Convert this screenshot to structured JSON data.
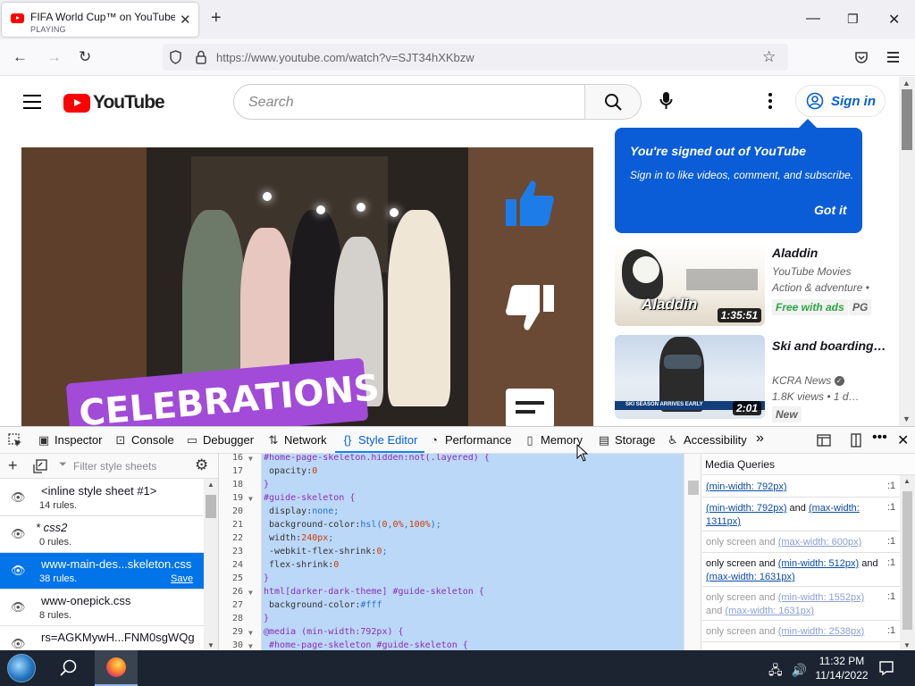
{
  "browser": {
    "tab_title": "FIFA World Cup™ on YouTube",
    "tab_status": "PLAYING",
    "url": "https://www.youtube.com/watch?v=SJT34hXKbzw"
  },
  "youtube": {
    "logo_text": "YouTube",
    "search_placeholder": "Search",
    "sign_in": "Sign in",
    "tooltip": {
      "heading": "You're signed out of YouTube",
      "subtext": "Sign in to like videos, comment, and subscribe.",
      "button": "Got it"
    },
    "video_overlay_text": "CELEBRATIONS",
    "recommendations": [
      {
        "title": "Aladdin",
        "channel": "YouTube Movies",
        "meta": "Action & adventure •",
        "duration": "1:35:51",
        "badge1": "Free with ads",
        "badge2": "PG",
        "thumb_caption": "Aladdin"
      },
      {
        "title": "Ski and boarding…",
        "channel": "KCRA News",
        "meta": "1.8K views  • 1 d…",
        "duration": "2:01",
        "badge1": "New",
        "thumb_caption": "SKI SEASON ARRIVES EARLY"
      }
    ]
  },
  "devtools": {
    "tabs": [
      {
        "label": "Inspector",
        "icon": "inspector-icon"
      },
      {
        "label": "Console",
        "icon": "console-icon"
      },
      {
        "label": "Debugger",
        "icon": "debugger-icon"
      },
      {
        "label": "Network",
        "icon": "network-icon"
      },
      {
        "label": "Style Editor",
        "icon": "style-editor-icon"
      },
      {
        "label": "Performance",
        "icon": "performance-icon"
      },
      {
        "label": "Memory",
        "icon": "memory-icon"
      },
      {
        "label": "Storage",
        "icon": "storage-icon"
      },
      {
        "label": "Accessibility",
        "icon": "accessibility-icon"
      }
    ],
    "selected_tab": "Style Editor",
    "filter_placeholder": "Filter style sheets",
    "stylesheets": [
      {
        "name": "<inline style sheet #1>",
        "rules": "14 rules."
      },
      {
        "name": "* css2",
        "rules": "0 rules."
      },
      {
        "name": "www-main-des...skeleton.css",
        "rules": "38 rules.",
        "save": "Save",
        "selected": true
      },
      {
        "name": "www-onepick.css",
        "rules": "8 rules."
      },
      {
        "name": "rs=AGKMywH...FNM0sgWQg",
        "rules": ""
      }
    ],
    "code_lines": [
      {
        "n": "16",
        "fold": true,
        "text": "#home-page-skeleton.hidden:not(.layered) {"
      },
      {
        "n": "17",
        "text": " opacity:0"
      },
      {
        "n": "18",
        "text": "}"
      },
      {
        "n": "19",
        "fold": true,
        "text": "#guide-skeleton {"
      },
      {
        "n": "20",
        "text": " display:none;"
      },
      {
        "n": "21",
        "text": " background-color:hsl(0,0%,100%);"
      },
      {
        "n": "22",
        "text": " width:240px;"
      },
      {
        "n": "23",
        "text": " -webkit-flex-shrink:0;"
      },
      {
        "n": "24",
        "text": " flex-shrink:0"
      },
      {
        "n": "25",
        "text": "}"
      },
      {
        "n": "26",
        "fold": true,
        "text": "html[darker-dark-theme] #guide-skeleton {"
      },
      {
        "n": "27",
        "text": " background-color:#fff"
      },
      {
        "n": "28",
        "text": "}"
      },
      {
        "n": "29",
        "fold": true,
        "text": "@media (min-width:792px) {"
      },
      {
        "n": "30",
        "fold": true,
        "text": " #home-page-skeleton #guide-skeleton {"
      }
    ],
    "media_queries_title": "Media Queries",
    "media_queries": [
      {
        "parts": [
          {
            "t": "(min-width: 792px)",
            "link": true
          }
        ],
        "line": ":1",
        "dim": false
      },
      {
        "parts": [
          {
            "t": "(min-width: 792px)",
            "link": true
          },
          {
            "t": " and ",
            "link": false
          },
          {
            "t": "(max-width: 1311px)",
            "link": true
          }
        ],
        "line": ":1",
        "dim": false
      },
      {
        "parts": [
          {
            "t": "only screen and ",
            "link": false
          },
          {
            "t": "(max-width: 600px)",
            "link": true
          }
        ],
        "line": ":1",
        "dim": true
      },
      {
        "parts": [
          {
            "t": "only screen and ",
            "link": false
          },
          {
            "t": "(min-width: 512px)",
            "link": true
          },
          {
            "t": " and ",
            "link": false
          },
          {
            "t": "(max-width: 1631px)",
            "link": true
          }
        ],
        "line": ":1",
        "dim": false
      },
      {
        "parts": [
          {
            "t": "only screen and ",
            "link": false
          },
          {
            "t": "(min-width: 1552px)",
            "link": true
          },
          {
            "t": " and ",
            "link": false
          },
          {
            "t": "(max-width: 1631px)",
            "link": true
          }
        ],
        "line": ":1",
        "dim": true
      },
      {
        "parts": [
          {
            "t": "only screen and ",
            "link": false
          },
          {
            "t": "(min-width: 2538px)",
            "link": true
          }
        ],
        "line": ":1",
        "dim": true
      }
    ]
  },
  "taskbar": {
    "time": "11:32 PM",
    "date": "11/14/2022"
  },
  "colors": {
    "yt_red": "#ff0000",
    "tooltip_blue": "#0a5dd6",
    "selection_blue": "#0074e8",
    "devtools_accent": "#0060df"
  }
}
